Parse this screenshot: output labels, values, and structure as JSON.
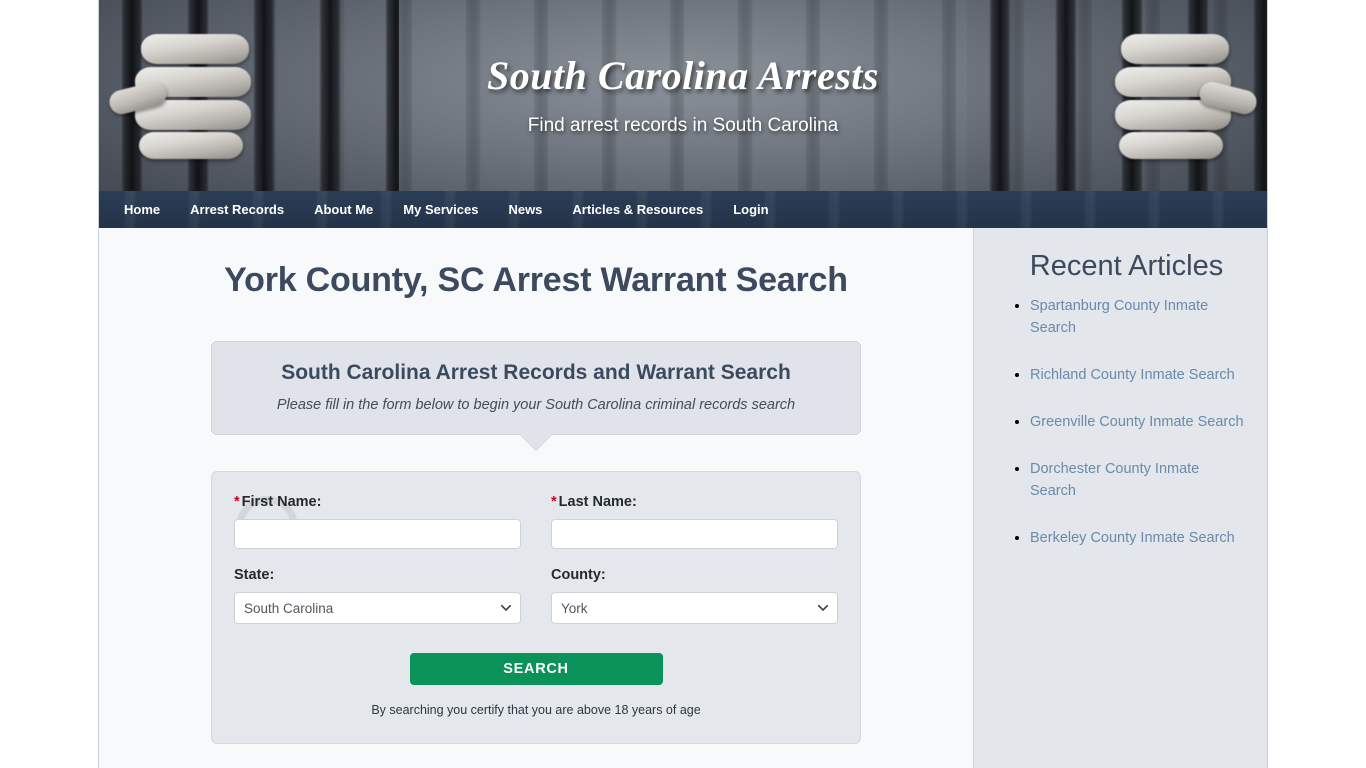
{
  "header": {
    "site_title": "South Carolina Arrests",
    "tagline": "Find arrest records in South Carolina"
  },
  "nav": {
    "items": [
      {
        "label": "Home"
      },
      {
        "label": "Arrest Records"
      },
      {
        "label": "About Me"
      },
      {
        "label": "My Services"
      },
      {
        "label": "News"
      },
      {
        "label": "Articles & Resources"
      },
      {
        "label": "Login"
      }
    ]
  },
  "main": {
    "page_title": "York County, SC Arrest Warrant Search",
    "callout": {
      "title": "South Carolina Arrest Records and Warrant Search",
      "subtitle": "Please fill in the form below to begin your South Carolina criminal records search"
    },
    "form": {
      "first_name": {
        "required_marker": "*",
        "label": "First Name:",
        "value": "",
        "placeholder": ""
      },
      "last_name": {
        "required_marker": "*",
        "label": "Last Name:",
        "value": "",
        "placeholder": ""
      },
      "state": {
        "label": "State:",
        "selected": "South Carolina",
        "options": [
          "South Carolina"
        ]
      },
      "county": {
        "label": "County:",
        "selected": "York",
        "options": [
          "York"
        ]
      },
      "submit_label": "SEARCH",
      "disclaimer": "By searching you certify that you are above 18 years of age"
    }
  },
  "sidebar": {
    "title": "Recent Articles",
    "items": [
      {
        "label": "Spartanburg County Inmate Search"
      },
      {
        "label": "Richland County Inmate Search"
      },
      {
        "label": "Greenville County Inmate Search"
      },
      {
        "label": "Dorchester County Inmate Search"
      },
      {
        "label": "Berkeley County Inmate Search"
      }
    ]
  },
  "colors": {
    "nav_bg": "#243348",
    "heading": "#3c4a5f",
    "link": "#6a89ad",
    "button_green": "#0a9259",
    "required_red": "#d0021b",
    "panel_bg": "#e4e8ed",
    "sidebar_bg": "#e3e7ec"
  }
}
